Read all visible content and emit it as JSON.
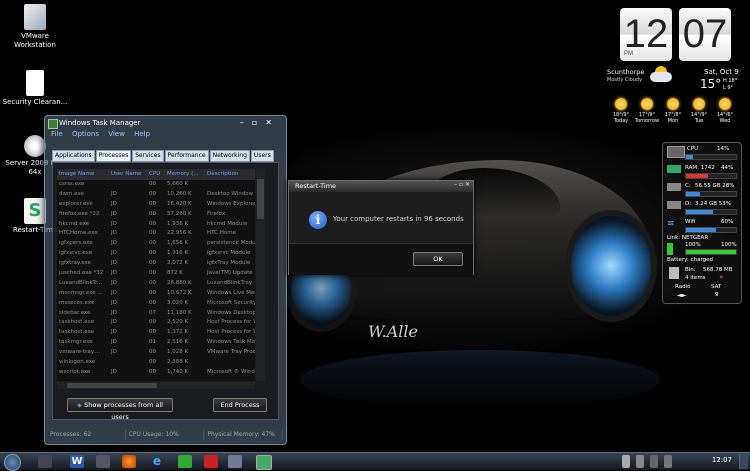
{
  "desktop_icons": [
    {
      "label": "VMware Workstation"
    },
    {
      "label": "Security Clearan..."
    },
    {
      "label": "Server 2008 RC2 64x"
    },
    {
      "label": "Restart-Time"
    }
  ],
  "task_manager": {
    "title": "Windows Task Manager",
    "menu": [
      "File",
      "Options",
      "View",
      "Help"
    ],
    "tabs": [
      "Applications",
      "Processes",
      "Services",
      "Performance",
      "Networking",
      "Users"
    ],
    "columns": [
      "Image Name",
      "User Name",
      "CPU",
      "Memory (...",
      "Description"
    ],
    "rows": [
      [
        "csrss.exe",
        "",
        "00",
        "5,660 K",
        ""
      ],
      [
        "dwm.exe",
        "JD",
        "00",
        "10,260 K",
        "Desktop Window M"
      ],
      [
        "explorer.exe",
        "JD",
        "00",
        "16,420 K",
        "Windows Explorer"
      ],
      [
        "firefox.exe *32",
        "JD",
        "00",
        "57,260 K",
        "Firefox"
      ],
      [
        "hkcmd.exe",
        "JD",
        "00",
        "1,936 K",
        "hkcmd Module"
      ],
      [
        "HTCHome.exe",
        "JD",
        "00",
        "22,956 K",
        "HTC Home"
      ],
      [
        "igfxpers.exe",
        "JD",
        "00",
        "1,656 K",
        "persistence Module"
      ],
      [
        "igfxsrvc.exe",
        "JD",
        "00",
        "1,916 K",
        "igfxsrvc Module"
      ],
      [
        "igfxtray.exe",
        "JD",
        "00",
        "2,072 K",
        "igfxTray Module"
      ],
      [
        "jusched.exe *32",
        "JD",
        "00",
        "872 K",
        "Java(TM) Update"
      ],
      [
        "LuxandBlinkTr...",
        "JD",
        "00",
        "28,880 K",
        "LuxandBlinkTray"
      ],
      [
        "msnmsgr.exe ...",
        "JD",
        "00",
        "10,672 K",
        "Windows Live Mes"
      ],
      [
        "msseces.exe",
        "JD",
        "00",
        "3,020 K",
        "Microsoft Security"
      ],
      [
        "sidebar.exe",
        "JD",
        "07",
        "11,180 K",
        "Windows Desktop"
      ],
      [
        "taskhost.exe",
        "JD",
        "00",
        "2,520 K",
        "Host Process for W"
      ],
      [
        "taskhost.exe",
        "JD",
        "00",
        "1,372 K",
        "Host Process for W"
      ],
      [
        "taskmgr.exe",
        "JD",
        "01",
        "2,516 K",
        "Windows Task Man"
      ],
      [
        "vmware-tray....",
        "JD",
        "00",
        "1,028 K",
        "VMware Tray Proc"
      ],
      [
        "winlogon.exe",
        "",
        "00",
        "2,388 K",
        ""
      ],
      [
        "wscript.exe",
        "JD",
        "00",
        "1,740 K",
        "Microsoft ® Wind"
      ]
    ],
    "show_all_label": "Show processes from all users",
    "end_process_label": "End Process",
    "status": {
      "processes": "Processes: 62",
      "cpu": "CPU Usage: 10%",
      "memory": "Physical Memory: 47%"
    }
  },
  "dialog": {
    "title": "Restart-Time",
    "message": "Your computer restarts in 96 seconds",
    "ok_label": "OK"
  },
  "clock": {
    "hour": "12",
    "minute": "07",
    "ampm": "PM"
  },
  "weather": {
    "city": "Scunthorpe",
    "condition": "Mostly Cloudy",
    "date": "Sat, Oct 9",
    "temp": "15°",
    "hi": "H 18°",
    "lo": "L 9°",
    "forecast": [
      {
        "temps": "18°/9°",
        "day": "Today"
      },
      {
        "temps": "17°/9°",
        "day": "Tomorrow"
      },
      {
        "temps": "17°/8°",
        "day": "Mon"
      },
      {
        "temps": "14°/9°",
        "day": "Tue"
      },
      {
        "temps": "14°/6°",
        "day": "Wed"
      }
    ]
  },
  "gauges": {
    "cpu_label": "CPU",
    "cpu_value": "14%",
    "ram_label": "RAM: 1742",
    "ram_value": "44%",
    "c_label": "C:",
    "c_value": "56.55 GB 28%",
    "d_label": "D:",
    "d_value": "3.24 GB 53%",
    "wifi_label": "Wifi",
    "wifi_value": "60%",
    "link": "Link: NETGEAR",
    "battery_value": "100%",
    "battery_value2": "100%",
    "battery_status": "Battery: charged",
    "bin_label": "Bin:",
    "bin_size": "568.78 MB",
    "bin_items": "4 items",
    "radio_label": "Radio",
    "day": "SAT",
    "daynum": "9"
  },
  "taskbar": {
    "time": "12:07"
  }
}
